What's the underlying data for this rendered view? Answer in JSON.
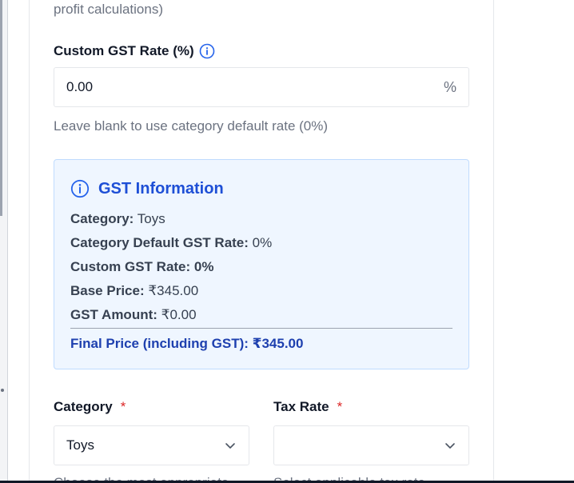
{
  "top_hint": "profit calculations)",
  "custom_gst": {
    "label": "Custom GST Rate (%)",
    "value": "0.00",
    "suffix": "%",
    "help": "Leave blank to use category default rate (0%)",
    "info_icon": "info-circle-icon"
  },
  "gst_info": {
    "title": "GST Information",
    "icon": "info-circle-icon",
    "category_label": "Category:",
    "category_value": "Toys",
    "default_rate_label": "Category Default GST Rate:",
    "default_rate_value": "0%",
    "custom_rate_label": "Custom GST Rate:",
    "custom_rate_value": "0%",
    "base_price_label": "Base Price:",
    "base_price_value": "₹345.00",
    "gst_amount_label": "GST Amount:",
    "gst_amount_value": "₹0.00",
    "final_price": "Final Price (including GST): ₹345.00"
  },
  "category_field": {
    "label": "Category",
    "required_mark": "*",
    "value": "Toys",
    "help_cut": "Choose the most appropriate"
  },
  "tax_rate_field": {
    "label": "Tax Rate",
    "required_mark": "*",
    "value": "",
    "help_cut": "Select applicable tax rate"
  },
  "colors": {
    "accent": "#1e4fd6",
    "info_bg": "#eff6ff",
    "required": "#dc2626"
  }
}
